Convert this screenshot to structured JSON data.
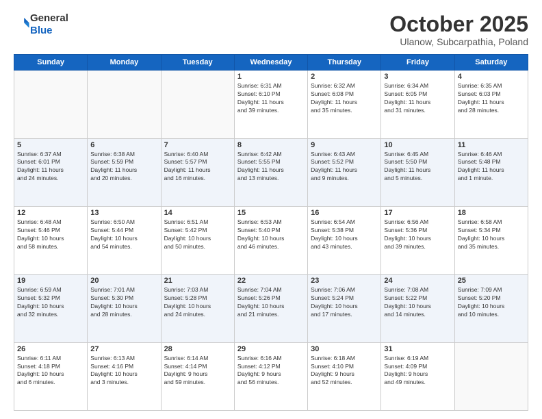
{
  "logo": {
    "general": "General",
    "blue": "Blue"
  },
  "header": {
    "month": "October 2025",
    "location": "Ulanow, Subcarpathia, Poland"
  },
  "weekdays": [
    "Sunday",
    "Monday",
    "Tuesday",
    "Wednesday",
    "Thursday",
    "Friday",
    "Saturday"
  ],
  "weeks": [
    [
      {
        "day": "",
        "info": ""
      },
      {
        "day": "",
        "info": ""
      },
      {
        "day": "",
        "info": ""
      },
      {
        "day": "1",
        "info": "Sunrise: 6:31 AM\nSunset: 6:10 PM\nDaylight: 11 hours\nand 39 minutes."
      },
      {
        "day": "2",
        "info": "Sunrise: 6:32 AM\nSunset: 6:08 PM\nDaylight: 11 hours\nand 35 minutes."
      },
      {
        "day": "3",
        "info": "Sunrise: 6:34 AM\nSunset: 6:05 PM\nDaylight: 11 hours\nand 31 minutes."
      },
      {
        "day": "4",
        "info": "Sunrise: 6:35 AM\nSunset: 6:03 PM\nDaylight: 11 hours\nand 28 minutes."
      }
    ],
    [
      {
        "day": "5",
        "info": "Sunrise: 6:37 AM\nSunset: 6:01 PM\nDaylight: 11 hours\nand 24 minutes."
      },
      {
        "day": "6",
        "info": "Sunrise: 6:38 AM\nSunset: 5:59 PM\nDaylight: 11 hours\nand 20 minutes."
      },
      {
        "day": "7",
        "info": "Sunrise: 6:40 AM\nSunset: 5:57 PM\nDaylight: 11 hours\nand 16 minutes."
      },
      {
        "day": "8",
        "info": "Sunrise: 6:42 AM\nSunset: 5:55 PM\nDaylight: 11 hours\nand 13 minutes."
      },
      {
        "day": "9",
        "info": "Sunrise: 6:43 AM\nSunset: 5:52 PM\nDaylight: 11 hours\nand 9 minutes."
      },
      {
        "day": "10",
        "info": "Sunrise: 6:45 AM\nSunset: 5:50 PM\nDaylight: 11 hours\nand 5 minutes."
      },
      {
        "day": "11",
        "info": "Sunrise: 6:46 AM\nSunset: 5:48 PM\nDaylight: 11 hours\nand 1 minute."
      }
    ],
    [
      {
        "day": "12",
        "info": "Sunrise: 6:48 AM\nSunset: 5:46 PM\nDaylight: 10 hours\nand 58 minutes."
      },
      {
        "day": "13",
        "info": "Sunrise: 6:50 AM\nSunset: 5:44 PM\nDaylight: 10 hours\nand 54 minutes."
      },
      {
        "day": "14",
        "info": "Sunrise: 6:51 AM\nSunset: 5:42 PM\nDaylight: 10 hours\nand 50 minutes."
      },
      {
        "day": "15",
        "info": "Sunrise: 6:53 AM\nSunset: 5:40 PM\nDaylight: 10 hours\nand 46 minutes."
      },
      {
        "day": "16",
        "info": "Sunrise: 6:54 AM\nSunset: 5:38 PM\nDaylight: 10 hours\nand 43 minutes."
      },
      {
        "day": "17",
        "info": "Sunrise: 6:56 AM\nSunset: 5:36 PM\nDaylight: 10 hours\nand 39 minutes."
      },
      {
        "day": "18",
        "info": "Sunrise: 6:58 AM\nSunset: 5:34 PM\nDaylight: 10 hours\nand 35 minutes."
      }
    ],
    [
      {
        "day": "19",
        "info": "Sunrise: 6:59 AM\nSunset: 5:32 PM\nDaylight: 10 hours\nand 32 minutes."
      },
      {
        "day": "20",
        "info": "Sunrise: 7:01 AM\nSunset: 5:30 PM\nDaylight: 10 hours\nand 28 minutes."
      },
      {
        "day": "21",
        "info": "Sunrise: 7:03 AM\nSunset: 5:28 PM\nDaylight: 10 hours\nand 24 minutes."
      },
      {
        "day": "22",
        "info": "Sunrise: 7:04 AM\nSunset: 5:26 PM\nDaylight: 10 hours\nand 21 minutes."
      },
      {
        "day": "23",
        "info": "Sunrise: 7:06 AM\nSunset: 5:24 PM\nDaylight: 10 hours\nand 17 minutes."
      },
      {
        "day": "24",
        "info": "Sunrise: 7:08 AM\nSunset: 5:22 PM\nDaylight: 10 hours\nand 14 minutes."
      },
      {
        "day": "25",
        "info": "Sunrise: 7:09 AM\nSunset: 5:20 PM\nDaylight: 10 hours\nand 10 minutes."
      }
    ],
    [
      {
        "day": "26",
        "info": "Sunrise: 6:11 AM\nSunset: 4:18 PM\nDaylight: 10 hours\nand 6 minutes."
      },
      {
        "day": "27",
        "info": "Sunrise: 6:13 AM\nSunset: 4:16 PM\nDaylight: 10 hours\nand 3 minutes."
      },
      {
        "day": "28",
        "info": "Sunrise: 6:14 AM\nSunset: 4:14 PM\nDaylight: 9 hours\nand 59 minutes."
      },
      {
        "day": "29",
        "info": "Sunrise: 6:16 AM\nSunset: 4:12 PM\nDaylight: 9 hours\nand 56 minutes."
      },
      {
        "day": "30",
        "info": "Sunrise: 6:18 AM\nSunset: 4:10 PM\nDaylight: 9 hours\nand 52 minutes."
      },
      {
        "day": "31",
        "info": "Sunrise: 6:19 AM\nSunset: 4:09 PM\nDaylight: 9 hours\nand 49 minutes."
      },
      {
        "day": "",
        "info": ""
      }
    ]
  ]
}
